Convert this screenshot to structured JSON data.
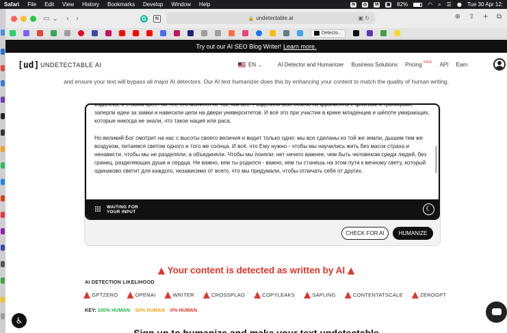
{
  "menubar": {
    "app": "Safari",
    "items": [
      "File",
      "Edit",
      "View",
      "History",
      "Bookmarks",
      "Develop",
      "Window",
      "Help"
    ],
    "battery": "82%",
    "clock": "Tue 30 Apr  12:"
  },
  "browser": {
    "url": "undetectable.ai",
    "active_tab": "Detecto..."
  },
  "promo": {
    "text": "Try out our AI SEO Blog Writer!",
    "link": "Learn more."
  },
  "header": {
    "logo": "[ud]",
    "brand": "UNDETECTABLE AI",
    "language": "EN",
    "nav": {
      "detector": "AI Detector and Humanizer",
      "business": "Business Solutions",
      "pricing": "Pricing",
      "sale": "SALE",
      "api": "API",
      "earn": "Earn"
    }
  },
  "intro": "and ensure your text will bypass all major AI detectors. Our AI text humanizer does this by enhancing your content to match the quality of human writing.",
  "editor": {
    "text_top": "издалека, и ставим крест на тех, кто молится не так, как все. Разделили всю Землю на фрагменты с флагами и границами, заперли идеи за замки и навесили цепи на двери университетов. И всё это при участии в крике младенцев и шёпоте умирающих, которые никогда не знали, что такое нация или раса.",
    "text_bottom": "Но великий Бог смотрит на нас с высоты своего величия и видит только одно: мы все сделаны из той же земли, дышим тем же воздухом, питаемся светом одного и того же солнца. И всё, что Ему нужно - чтобы мы научились жить без масок страха и ненависти, чтобы мы не разделяли, а объединяли. Чтобы мы поняли: нет ничего важнее, чем быть человеком среди людей, без границ, разделяющих души и сердца. Не важно, кем ты родился - важно, кем ты станешь на этом пути к вечному свету, который одинаково светит для каждого, независимо от всего, что мы придумали, чтобы отличать себя от других.",
    "status_line1": "WAITING FOR",
    "status_line2": "YOUR INPUT",
    "check_button": "CHECK FOR AI",
    "humanize_button": "HUMANIZE"
  },
  "result": {
    "headline": "Your content is detected as written by AI",
    "likelihood_label": "AI DETECTION LIKELIHOOD",
    "detectors": [
      "GPTZERO",
      "OPENAI",
      "WRITER",
      "CROSSPLAG",
      "COPYLEAKS",
      "SAPLING",
      "CONTENTATSCALE",
      "ZEROGPT"
    ],
    "key_label": "KEY:",
    "key_human": "100% HUMAN",
    "key_half": "50% HUMAN",
    "key_zero": "0% HUMAN",
    "signup": "Sign up to humanize and make your text undetectable"
  },
  "colors": {
    "danger": "#e0342a",
    "human": "#22b14c",
    "half": "#f3a21a",
    "dark": "#111111"
  }
}
